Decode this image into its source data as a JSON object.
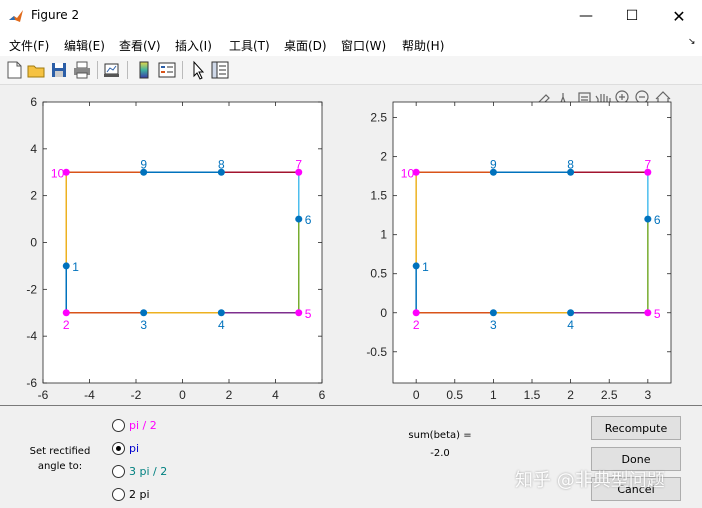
{
  "window": {
    "title": "Figure 2",
    "minimize_icon": "minimize-icon",
    "maximize_icon": "maximize-icon",
    "close_icon": "close-icon"
  },
  "menubar": {
    "items": [
      "文件(F)",
      "编辑(E)",
      "查看(V)",
      "插入(I)",
      "工具(T)",
      "桌面(D)",
      "窗口(W)",
      "帮助(H)"
    ],
    "dock_arrow": "↘"
  },
  "toolbar": {
    "icons": [
      "new-figure-icon",
      "open-file-icon",
      "save-icon",
      "print-icon",
      "link-plot-icon",
      "insert-colorbar-icon",
      "insert-legend-icon",
      "edit-plot-arrow-icon",
      "property-inspector-icon"
    ]
  },
  "axes_toolbar": {
    "icons": [
      "brush-icon",
      "data-tips-icon",
      "export-icon",
      "pan-icon",
      "zoom-in-icon",
      "zoom-out-icon",
      "home-icon"
    ]
  },
  "colors": {
    "blue": "#0072bd",
    "orange": "#d95319",
    "yellow": "#edb120",
    "purple": "#7e2f8e",
    "green": "#77ac30",
    "cyan": "#4dbeee",
    "red": "#a2142f",
    "magenta": "#ff00ff"
  },
  "chart_data": [
    {
      "type": "line",
      "xlim": [
        -6,
        6
      ],
      "ylim": [
        -6,
        6
      ],
      "xticks": [
        -6,
        -4,
        -2,
        0,
        2,
        4,
        6
      ],
      "yticks": [
        -6,
        -4,
        -2,
        0,
        2,
        4,
        6
      ],
      "points": [
        {
          "label": "1",
          "x": -5,
          "y": -1,
          "marker": "blue"
        },
        {
          "label": "2",
          "x": -5,
          "y": -3,
          "marker": "magenta"
        },
        {
          "label": "3",
          "x": -1.67,
          "y": -3,
          "marker": "blue"
        },
        {
          "label": "4",
          "x": 1.67,
          "y": -3,
          "marker": "blue"
        },
        {
          "label": "5",
          "x": 5,
          "y": -3,
          "marker": "magenta"
        },
        {
          "label": "6",
          "x": 5,
          "y": 1,
          "marker": "blue"
        },
        {
          "label": "7",
          "x": 5,
          "y": 3,
          "marker": "magenta"
        },
        {
          "label": "8",
          "x": 1.67,
          "y": 3,
          "marker": "blue"
        },
        {
          "label": "9",
          "x": -1.67,
          "y": 3,
          "marker": "blue"
        },
        {
          "label": "10",
          "x": -5,
          "y": 3,
          "marker": "magenta"
        }
      ],
      "segment_colors": [
        "blue",
        "orange",
        "yellow",
        "purple",
        "green",
        "cyan",
        "red",
        "blue",
        "orange",
        "yellow"
      ]
    },
    {
      "type": "line",
      "xlim": [
        -0.3,
        3.3
      ],
      "ylim": [
        -0.9,
        2.7
      ],
      "xticks": [
        0,
        0.5,
        1,
        1.5,
        2,
        2.5,
        3
      ],
      "yticks": [
        -0.5,
        0,
        0.5,
        1,
        1.5,
        2,
        2.5
      ],
      "points": [
        {
          "label": "1",
          "x": 0,
          "y": 0.6,
          "marker": "blue"
        },
        {
          "label": "2",
          "x": 0,
          "y": 0,
          "marker": "magenta"
        },
        {
          "label": "3",
          "x": 1,
          "y": 0,
          "marker": "blue"
        },
        {
          "label": "4",
          "x": 2,
          "y": 0,
          "marker": "blue"
        },
        {
          "label": "5",
          "x": 3,
          "y": 0,
          "marker": "magenta"
        },
        {
          "label": "6",
          "x": 3,
          "y": 1.2,
          "marker": "blue"
        },
        {
          "label": "7",
          "x": 3,
          "y": 1.8,
          "marker": "magenta"
        },
        {
          "label": "8",
          "x": 2,
          "y": 1.8,
          "marker": "blue"
        },
        {
          "label": "9",
          "x": 1,
          "y": 1.8,
          "marker": "blue"
        },
        {
          "label": "10",
          "x": 0,
          "y": 1.8,
          "marker": "magenta"
        }
      ],
      "segment_colors": [
        "blue",
        "orange",
        "yellow",
        "purple",
        "green",
        "cyan",
        "red",
        "blue",
        "orange",
        "yellow"
      ]
    }
  ],
  "controls": {
    "set_label": "Set rectified angle to:",
    "radios": [
      {
        "label": "pi / 2",
        "color": "#ff00ff",
        "selected": false
      },
      {
        "label": "pi",
        "color": "#0000cc",
        "selected": true
      },
      {
        "label": "3 pi / 2",
        "color": "#008080",
        "selected": false
      },
      {
        "label": "2 pi",
        "color": "#000000",
        "selected": false
      }
    ],
    "sum_label": "sum(beta) =",
    "sum_value": "-2.0",
    "buttons": {
      "recompute": "Recompute",
      "done": "Done",
      "cancel": "Cancel"
    }
  },
  "watermark": "知乎 @非典型问题"
}
